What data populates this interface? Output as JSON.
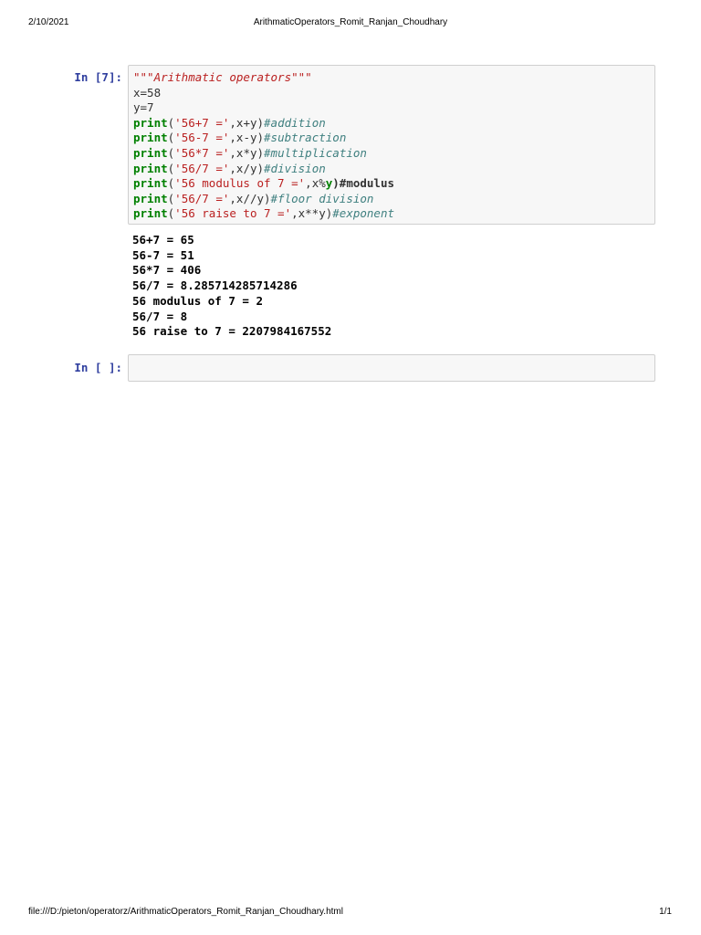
{
  "header": {
    "date": "2/10/2021",
    "title": "ArithmaticOperators_Romit_Ranjan_Choudhary"
  },
  "footer": {
    "path": "file:///D:/pieton/operatorz/ArithmaticOperators_Romit_Ranjan_Choudhary.html",
    "page": "1/1"
  },
  "cells": [
    {
      "prompt": "In [7]:",
      "code_lines": [
        [
          {
            "t": "\"\"\"Arithmatic operators\"\"\"",
            "c": "doc"
          }
        ],
        [
          {
            "t": "x=58",
            "c": "plain"
          }
        ],
        [
          {
            "t": "y=7",
            "c": "plain"
          }
        ],
        [
          {
            "t": "print",
            "c": "kw"
          },
          {
            "t": "(",
            "c": "plain"
          },
          {
            "t": "'56+7 ='",
            "c": "str"
          },
          {
            "t": ",x+y)",
            "c": "plain"
          },
          {
            "t": "#addition",
            "c": "cm"
          }
        ],
        [
          {
            "t": "print",
            "c": "kw"
          },
          {
            "t": "(",
            "c": "plain"
          },
          {
            "t": "'56-7 ='",
            "c": "str"
          },
          {
            "t": ",x-y)",
            "c": "plain"
          },
          {
            "t": "#subtraction",
            "c": "cm"
          }
        ],
        [
          {
            "t": "print",
            "c": "kw"
          },
          {
            "t": "(",
            "c": "plain"
          },
          {
            "t": "'56*7 ='",
            "c": "str"
          },
          {
            "t": ",x*y)",
            "c": "plain"
          },
          {
            "t": "#multiplication",
            "c": "cm"
          }
        ],
        [
          {
            "t": "print",
            "c": "kw"
          },
          {
            "t": "(",
            "c": "plain"
          },
          {
            "t": "'56/7 ='",
            "c": "str"
          },
          {
            "t": ",x/y)",
            "c": "plain"
          },
          {
            "t": "#division",
            "c": "cm"
          }
        ],
        [
          {
            "t": "print",
            "c": "kw"
          },
          {
            "t": "(",
            "c": "plain"
          },
          {
            "t": "'56 modulus of 7 ='",
            "c": "str"
          },
          {
            "t": ",x%",
            "c": "plain"
          },
          {
            "t": "y",
            "c": "ybold"
          },
          {
            "t": ")#modulus",
            "c": "bold"
          }
        ],
        [
          {
            "t": "print",
            "c": "kw"
          },
          {
            "t": "(",
            "c": "plain"
          },
          {
            "t": "'56/7 ='",
            "c": "str"
          },
          {
            "t": ",x//y)",
            "c": "plain"
          },
          {
            "t": "#floor division",
            "c": "cm"
          }
        ],
        [
          {
            "t": "print",
            "c": "kw"
          },
          {
            "t": "(",
            "c": "plain"
          },
          {
            "t": "'56 raise to 7 ='",
            "c": "str"
          },
          {
            "t": ",x**y)",
            "c": "plain"
          },
          {
            "t": "#exponent",
            "c": "cm"
          }
        ]
      ],
      "output_lines": [
        "56+7 = 65",
        "56-7 = 51",
        "56*7 = 406",
        "56/7 = 8.285714285714286",
        "56 modulus of 7 = 2",
        "56/7 = 8",
        "56 raise to 7 = 2207984167552"
      ]
    },
    {
      "prompt": "In [ ]:",
      "code": ""
    }
  ]
}
